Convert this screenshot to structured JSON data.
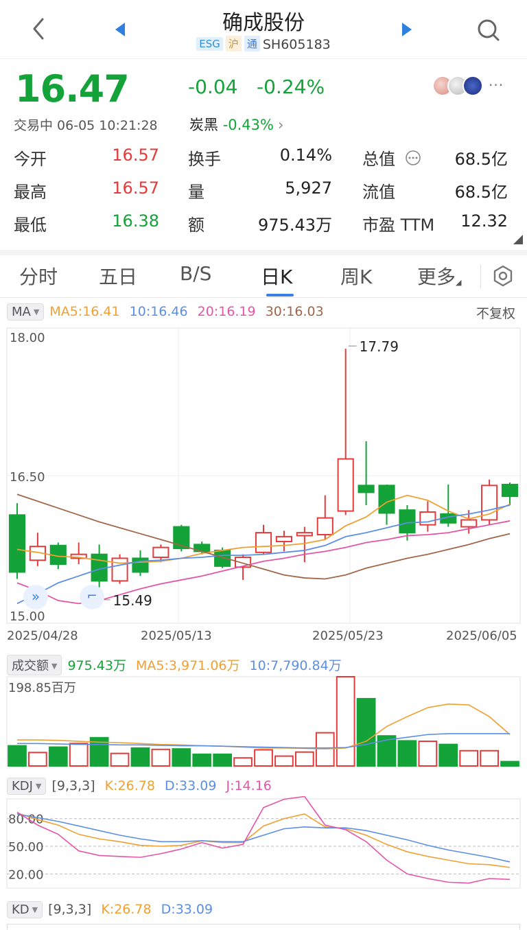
{
  "header": {
    "title": "确成股份",
    "tags": [
      "ESG",
      "沪",
      "通"
    ],
    "code": "SH605183"
  },
  "quote": {
    "price": "16.47",
    "change": "-0.04",
    "change_pct": "-0.24%",
    "status": "交易中 06-05 10:21:28",
    "sector_name": "炭黑",
    "sector_change": "-0.43%",
    "more": "···",
    "stats": [
      [
        {
          "label": "今开",
          "value": "16.57",
          "color": "red"
        },
        {
          "label": "换手",
          "value": "0.14%",
          "color": "dark"
        },
        {
          "label": "总值",
          "value": "68.5亿",
          "color": "dark"
        }
      ],
      [
        {
          "label": "最高",
          "value": "16.57",
          "color": "red"
        },
        {
          "label": "量",
          "value": "5,927",
          "color": "dark"
        },
        {
          "label": "流值",
          "value": "68.5亿",
          "color": "dark"
        }
      ],
      [
        {
          "label": "最低",
          "value": "16.38",
          "color": "green"
        },
        {
          "label": "额",
          "value": "975.43万",
          "color": "dark"
        },
        {
          "label": "市盈 TTM",
          "value": "12.32",
          "color": "dark"
        }
      ]
    ]
  },
  "tabs": [
    "分时",
    "五日",
    "B/S",
    "日K",
    "周K",
    "更多"
  ],
  "active_tab": 3,
  "ma_legend": {
    "pill": "MA",
    "ma5": "MA5:16.41",
    "ma10": "10:16.46",
    "ma20": "20:16.19",
    "ma30": "30:16.03",
    "adjust": "不复权"
  },
  "vol_legend": {
    "pill": "成交额",
    "current": "975.43万",
    "ma5": "MA5:3,971.06万",
    "ma10": "10:7,790.84万",
    "max_label": "198.85百万"
  },
  "kdj_legend": {
    "pill": "KDJ",
    "params": "[9,3,3]",
    "k": "K:26.78",
    "d": "D:33.09",
    "j": "J:14.16"
  },
  "kd_legend": {
    "pill": "KD",
    "params": "[9,3,3]",
    "k": "K:26.78",
    "d": "D:33.09"
  },
  "colors": {
    "up": "#e33b3b",
    "down": "#14a338",
    "ma5": "#f0a030",
    "ma10": "#5b8ee6",
    "ma20": "#e455a8",
    "ma30": "#a0664a"
  },
  "chart_data": [
    {
      "type": "candlestick",
      "ylim": [
        15.0,
        18.0
      ],
      "y_ticks": [
        "18.00",
        "16.50",
        "15.00"
      ],
      "x_ticks": [
        "2025/04/28",
        "2025/05/13",
        "2025/05/23",
        "2025/06/05"
      ],
      "max_label": "17.79",
      "min_label": "15.49",
      "candles": [
        {
          "o": 16.1,
          "c": 15.52,
          "h": 16.22,
          "l": 15.45
        },
        {
          "o": 15.64,
          "c": 15.78,
          "h": 15.92,
          "l": 15.58
        },
        {
          "o": 15.79,
          "c": 15.6,
          "h": 15.82,
          "l": 15.55
        },
        {
          "o": 15.66,
          "c": 15.7,
          "h": 15.82,
          "l": 15.6
        },
        {
          "o": 15.7,
          "c": 15.43,
          "h": 15.8,
          "l": 15.28
        },
        {
          "o": 15.43,
          "c": 15.66,
          "h": 15.7,
          "l": 15.4
        },
        {
          "o": 15.66,
          "c": 15.52,
          "h": 15.74,
          "l": 15.48
        },
        {
          "o": 15.67,
          "c": 15.77,
          "h": 15.8,
          "l": 15.62
        },
        {
          "o": 15.98,
          "c": 15.76,
          "h": 16.0,
          "l": 15.73
        },
        {
          "o": 15.8,
          "c": 15.73,
          "h": 15.83,
          "l": 15.7
        },
        {
          "o": 15.74,
          "c": 15.58,
          "h": 15.77,
          "l": 15.56
        },
        {
          "o": 15.57,
          "c": 15.67,
          "h": 15.7,
          "l": 15.44
        },
        {
          "o": 15.72,
          "c": 15.92,
          "h": 16.0,
          "l": 15.7
        },
        {
          "o": 15.83,
          "c": 15.88,
          "h": 15.94,
          "l": 15.73
        },
        {
          "o": 15.89,
          "c": 15.92,
          "h": 15.98,
          "l": 15.62
        },
        {
          "o": 15.9,
          "c": 16.07,
          "h": 16.3,
          "l": 15.85
        },
        {
          "o": 16.14,
          "c": 16.67,
          "h": 17.79,
          "l": 16.1
        },
        {
          "o": 16.4,
          "c": 16.33,
          "h": 16.85,
          "l": 16.2
        },
        {
          "o": 16.4,
          "c": 16.12,
          "h": 16.41,
          "l": 16.0
        },
        {
          "o": 16.15,
          "c": 15.92,
          "h": 16.2,
          "l": 15.84
        },
        {
          "o": 16.0,
          "c": 16.13,
          "h": 16.24,
          "l": 15.93
        },
        {
          "o": 16.11,
          "c": 16.02,
          "h": 16.41,
          "l": 15.98
        },
        {
          "o": 15.98,
          "c": 16.05,
          "h": 16.15,
          "l": 15.91
        },
        {
          "o": 16.05,
          "c": 16.4,
          "h": 16.46,
          "l": 16.0
        },
        {
          "o": 16.41,
          "c": 16.29,
          "h": 16.43,
          "l": 16.2
        }
      ],
      "series": [
        {
          "name": "MA5",
          "values": [
            15.75,
            15.72,
            15.68,
            15.67,
            15.64,
            15.61,
            15.62,
            15.63,
            15.66,
            15.71,
            15.74,
            15.77,
            15.78,
            15.79,
            15.81,
            15.85,
            15.99,
            16.08,
            16.23,
            16.3,
            16.25,
            16.14,
            16.06,
            16.11,
            16.21
          ]
        },
        {
          "name": "MA10",
          "values": [
            15.2,
            15.3,
            15.41,
            15.48,
            15.55,
            15.59,
            15.63,
            15.64,
            15.66,
            15.67,
            15.69,
            15.69,
            15.7,
            15.72,
            15.74,
            15.79,
            15.88,
            15.92,
            15.97,
            16.02,
            16.03,
            16.08,
            16.11,
            16.15,
            16.2
          ]
        },
        {
          "name": "MA20",
          "values": [
            15.41,
            15.33,
            15.23,
            15.2,
            15.23,
            15.29,
            15.35,
            15.4,
            15.44,
            15.48,
            15.53,
            15.58,
            15.63,
            15.66,
            15.7,
            15.73,
            15.77,
            15.82,
            15.85,
            15.89,
            15.9,
            15.92,
            15.96,
            16.0,
            16.04
          ]
        },
        {
          "name": "MA30",
          "values": [
            16.31,
            16.24,
            16.17,
            16.1,
            16.03,
            15.97,
            15.91,
            15.85,
            15.79,
            15.73,
            15.67,
            15.61,
            15.55,
            15.49,
            15.46,
            15.45,
            15.49,
            15.56,
            15.61,
            15.66,
            15.7,
            15.75,
            15.8,
            15.86,
            15.91
          ]
        }
      ]
    },
    {
      "type": "bar",
      "ylim": [
        0,
        198.85
      ],
      "values": [
        45.0,
        30.0,
        42.0,
        50.0,
        63.0,
        28.0,
        40.0,
        37.0,
        38.0,
        26.0,
        26.0,
        18.0,
        36.0,
        22.0,
        31.0,
        74.0,
        198.85,
        150.0,
        67.0,
        56.0,
        55.0,
        48.0,
        34.0,
        34.0,
        9.75
      ],
      "up": [
        false,
        true,
        false,
        true,
        false,
        true,
        false,
        true,
        false,
        false,
        false,
        true,
        true,
        true,
        true,
        true,
        true,
        false,
        false,
        false,
        true,
        false,
        true,
        true,
        false
      ],
      "series": [
        {
          "name": "MA5",
          "values": [
            58,
            58,
            57,
            55,
            53,
            52,
            50,
            48,
            47,
            45,
            44,
            42,
            40,
            40,
            39,
            38,
            40,
            55,
            88,
            110,
            130,
            138,
            136,
            110,
            70,
            55,
            48
          ]
        },
        {
          "name": "10",
          "values": [
            50,
            50,
            49,
            48,
            48,
            47,
            47,
            46,
            45,
            45,
            44,
            43,
            42,
            41,
            40,
            40,
            41,
            48,
            58,
            64,
            70,
            72,
            72,
            72,
            72,
            72,
            72
          ]
        }
      ]
    },
    {
      "type": "line",
      "ylim": [
        0,
        100
      ],
      "y_ticks": [
        "80.00",
        "50.00",
        "20.00"
      ],
      "series": [
        {
          "name": "K",
          "values": [
            86,
            79,
            73,
            63,
            58,
            55,
            51,
            50,
            51,
            56,
            54,
            54,
            72,
            80,
            85,
            71,
            69,
            62,
            52,
            44,
            39,
            35,
            31,
            30,
            27
          ]
        },
        {
          "name": "D",
          "values": [
            85,
            81,
            77,
            72,
            67,
            62,
            58,
            55,
            55,
            56,
            55,
            55,
            62,
            69,
            71,
            70,
            70,
            67,
            62,
            57,
            51,
            46,
            42,
            38,
            33
          ]
        },
        {
          "name": "J",
          "values": [
            87,
            73,
            63,
            45,
            40,
            39,
            38,
            42,
            47,
            54,
            48,
            52,
            92,
            101,
            104,
            73,
            68,
            55,
            35,
            20,
            15,
            11,
            10,
            15,
            14
          ]
        }
      ]
    }
  ]
}
